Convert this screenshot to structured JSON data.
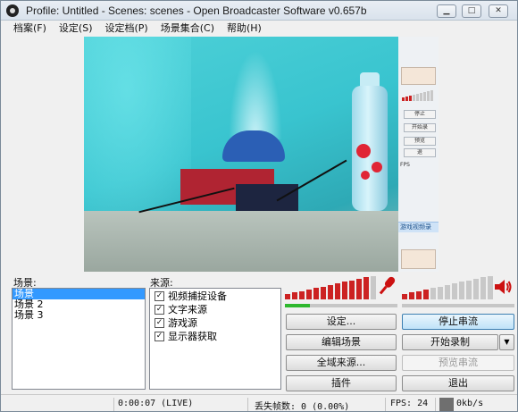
{
  "window": {
    "title": "Profile: Untitled - Scenes: scenes - Open Broadcaster Software v0.657b",
    "minimize_glyph": "▁",
    "maximize_glyph": "□",
    "close_glyph": "✕"
  },
  "menu": [
    {
      "label": "档案(F)"
    },
    {
      "label": "设定(S)"
    },
    {
      "label": "设定档(P)"
    },
    {
      "label": "场景集合(C)"
    },
    {
      "label": "帮助(H)"
    }
  ],
  "preview": {
    "side_panel_label": "游戏视频录",
    "side_fps": "FPS",
    "side_buttons": [
      "停止",
      "开始录",
      "预览",
      "退"
    ]
  },
  "scenes": {
    "label": "场景:",
    "items": [
      "场景",
      "场景 2",
      "场景 3"
    ],
    "selected_index": 0
  },
  "sources": {
    "label": "来源:",
    "items": [
      {
        "label": "视频捕捉设备",
        "checked": true
      },
      {
        "label": "文字来源",
        "checked": true
      },
      {
        "label": "游戏源",
        "checked": true
      },
      {
        "label": "显示器获取",
        "checked": true
      }
    ],
    "check_glyph": "✓"
  },
  "audio": {
    "mic_level": 0.92,
    "desktop_level": 0.32,
    "mic_icon": "microphone-icon",
    "speaker_icon": "speaker-icon",
    "meter_active_color": "#cc2222",
    "meter_inactive_color": "#c8c8c8",
    "meter_peak_color": "#2eb82e"
  },
  "buttons": {
    "settings": "设定...",
    "edit_scene": "编辑场景",
    "global_sources": "全域来源...",
    "plugins": "插件",
    "stop_stream": "停止串流",
    "start_recording": "开始录制",
    "start_recording_arrow": "▼",
    "preview_stream": "预览串流",
    "exit": "退出"
  },
  "status": {
    "time": "0:00:07 (LIVE)",
    "dropped_frames": "丢失帧数: 0 (0.00%)",
    "fps": "FPS: 24",
    "bitrate": "0kb/s",
    "bitrate_swatch_color": "#6f6f6f"
  }
}
